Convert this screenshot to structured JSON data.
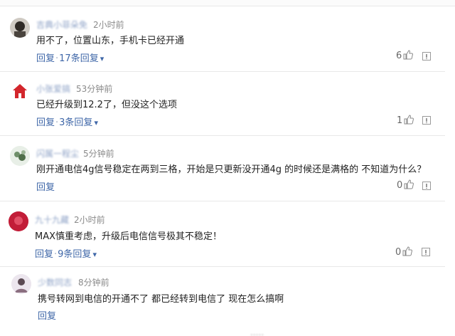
{
  "comments": [
    {
      "username": "吉典小菲朵免",
      "time": "2小时前",
      "text": "用不了，位置山东，手机卡已经开通",
      "reply_label": "回复",
      "replies_label": "17条回复",
      "likes": "6"
    },
    {
      "username": "小张爱搞",
      "time": "53分钟前",
      "text": "已经升级到12.2了，但没这个选项",
      "reply_label": "回复",
      "replies_label": "3条回复",
      "likes": "1"
    },
    {
      "username": "闪属一程尘",
      "time": "5分钟前",
      "text": "刚开通电信4g信号稳定在两到三格，开始是只更新没开通4g 的时候还是满格的 不知道为什么？",
      "reply_label": "回复",
      "likes": "0"
    },
    {
      "username": "九十九藏",
      "time": "2小时前",
      "text": "MAX慎重考虑，升级后电信信号极其不稳定！",
      "reply_label": "回复",
      "replies_label": "9条回复",
      "likes": "0"
    },
    {
      "username": "少数同志",
      "time": "8分钟前",
      "text": "携号转网到电信的开通不了 都已经转到电信了 现在怎么搞啊",
      "reply_label": "回复"
    }
  ],
  "colors": {
    "link": "#3f67a8",
    "username": "#8fa3c7",
    "divider": "#e8e8e8"
  },
  "icons": [
    "avatar",
    "thumb-up-icon",
    "report-icon",
    "chevron-down-icon"
  ]
}
